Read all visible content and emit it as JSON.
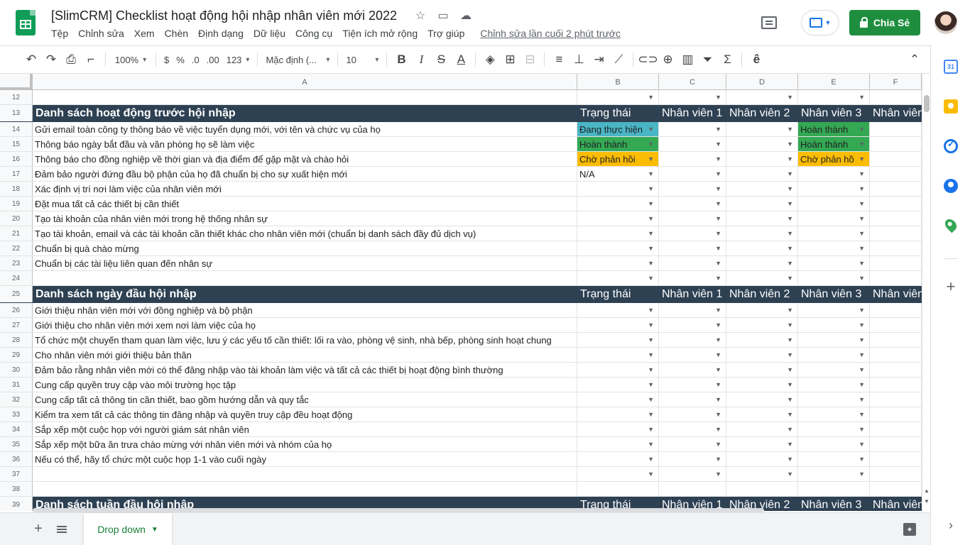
{
  "header": {
    "title": "[SlimCRM] Checklist hoạt động hội nhập nhân viên mới 2022",
    "menu": [
      "Tệp",
      "Chỉnh sửa",
      "Xem",
      "Chèn",
      "Định dạng",
      "Dữ liệu",
      "Công cụ",
      "Tiện ích mở rộng",
      "Trợ giúp"
    ],
    "last_edit": "Chỉnh sửa lần cuối 2 phút trước",
    "share_label": "Chia Sẻ"
  },
  "toolbar": {
    "zoom": "100%",
    "currency": "$",
    "percent": "%",
    "dec_decrease": ".0",
    "dec_increase": ".00",
    "format_more": "123",
    "font": "Mặc định (...",
    "font_size": "10"
  },
  "columns": [
    "A",
    "B",
    "C",
    "D",
    "E",
    "F"
  ],
  "rows": [
    {
      "n": "12",
      "type": "data",
      "a": "",
      "b": "",
      "c": "",
      "d": "",
      "e": ""
    },
    {
      "n": "13",
      "type": "header",
      "a": "Danh sách hoạt động trước hội nhập",
      "b": "Trạng thái",
      "c": "Nhân viên 1",
      "d": "Nhân viên 2",
      "e": "Nhân viên 3",
      "f": "Nhân viên"
    },
    {
      "n": "14",
      "type": "data",
      "a": "Gửi email toàn công ty thông báo về việc tuyển dụng mới, với tên và chức vụ của họ",
      "b": "Đang thực hiện",
      "c": "",
      "d": "",
      "e": "Hoàn thành"
    },
    {
      "n": "15",
      "type": "data",
      "a": "Thông báo ngày bắt đầu và văn phòng họ sẽ làm việc",
      "b": "Hoàn thành",
      "c": "",
      "d": "",
      "e": "Hoàn thành"
    },
    {
      "n": "16",
      "type": "data",
      "a": "Thông báo cho đồng nghiệp về thời gian và địa điểm để gặp mặt và chào hỏi",
      "b": "Chờ phản hồi",
      "c": "",
      "d": "",
      "e": "Chờ phản hồ"
    },
    {
      "n": "17",
      "type": "data",
      "a": " Đảm bảo người đứng đầu bộ phận của họ đã chuẩn bị cho sự xuất hiện mới",
      "b": "N/A",
      "c": "",
      "d": "",
      "e": ""
    },
    {
      "n": "18",
      "type": "data",
      "a": " Xác định vị trí nơi làm việc của nhân viên mới",
      "b": "",
      "c": "",
      "d": "",
      "e": ""
    },
    {
      "n": "19",
      "type": "data",
      "a": "Đặt mua tất cả các thiết bị cần thiết",
      "b": "",
      "c": "",
      "d": "",
      "e": ""
    },
    {
      "n": "20",
      "type": "data",
      "a": "Tạo tài khoản của nhân viên mới trong hệ thống nhân sự",
      "b": "",
      "c": "",
      "d": "",
      "e": ""
    },
    {
      "n": "21",
      "type": "data",
      "a": "Tạo tài khoản, email và các tài khoản cần thiết khác cho nhân viên mới (chuẩn bị danh sách đầy đủ dịch vụ)",
      "b": "",
      "c": "",
      "d": "",
      "e": ""
    },
    {
      "n": "22",
      "type": "data",
      "a": "Chuẩn bị quà chào mừng",
      "b": "",
      "c": "",
      "d": "",
      "e": ""
    },
    {
      "n": "23",
      "type": "data",
      "a": "Chuẩn bị các tài liệu liên quan đến nhân sự",
      "b": "",
      "c": "",
      "d": "",
      "e": ""
    },
    {
      "n": "24",
      "type": "data",
      "a": "",
      "b": "",
      "c": "",
      "d": "",
      "e": ""
    },
    {
      "n": "25",
      "type": "header",
      "a": "Danh sách ngày đầu hội nhập",
      "b": "Trạng thái",
      "c": "Nhân viên 1",
      "d": "Nhân viên 2",
      "e": "Nhân viên 3",
      "f": "Nhân viên"
    },
    {
      "n": "26",
      "type": "data",
      "a": "Giới thiệu nhân viên mới với đồng nghiệp và bộ phận",
      "b": "",
      "c": "",
      "d": "",
      "e": ""
    },
    {
      "n": "27",
      "type": "data",
      "a": "Giới thiệu cho nhân viên mới xem nơi làm việc của họ",
      "b": "",
      "c": "",
      "d": "",
      "e": ""
    },
    {
      "n": "28",
      "type": "data",
      "a": "Tổ chức một chuyến tham quan làm việc, lưu ý các yếu tố cần thiết: lối ra vào, phòng vệ sinh, nhà bếp, phòng sinh hoạt chung",
      "b": "",
      "c": "",
      "d": "",
      "e": ""
    },
    {
      "n": "29",
      "type": "data",
      "a": " Cho nhân viên mới giới thiệu bản thân",
      "b": "",
      "c": "",
      "d": "",
      "e": ""
    },
    {
      "n": "30",
      "type": "data",
      "a": "Đảm bảo rằng nhân viên mới có thể đăng nhập vào tài khoản làm việc và tất cả các thiết bị hoạt động bình thường",
      "b": "",
      "c": "",
      "d": "",
      "e": ""
    },
    {
      "n": "31",
      "type": "data",
      "a": "Cung cấp quyền truy cập vào môi trường học tập",
      "b": "",
      "c": "",
      "d": "",
      "e": ""
    },
    {
      "n": "32",
      "type": "data",
      "a": "Cung cấp tất cả thông tin cần thiết, bao gồm hướng dẫn và quy tắc",
      "b": "",
      "c": "",
      "d": "",
      "e": ""
    },
    {
      "n": "33",
      "type": "data",
      "a": "Kiểm tra xem tất cả các thông tin đăng nhập và quyền truy cập đều hoạt động",
      "b": "",
      "c": "",
      "d": "",
      "e": ""
    },
    {
      "n": "34",
      "type": "data",
      "a": "Sắp xếp một cuộc họp với người giám sát nhân viên",
      "b": "",
      "c": "",
      "d": "",
      "e": ""
    },
    {
      "n": "35",
      "type": "data",
      "a": "Sắp xếp một bữa ăn trưa chào mừng với nhân viên mới và nhóm của họ",
      "b": "",
      "c": "",
      "d": "",
      "e": ""
    },
    {
      "n": "36",
      "type": "data",
      "a": "Nếu có thể, hãy tổ chức một cuộc họp 1-1 vào cuối ngày",
      "b": "",
      "c": "",
      "d": "",
      "e": ""
    },
    {
      "n": "37",
      "type": "data",
      "a": "",
      "b": "",
      "c": "",
      "d": "",
      "e": ""
    },
    {
      "n": "38",
      "type": "blank",
      "a": ""
    },
    {
      "n": "39",
      "type": "header",
      "a": "Danh sách tuần đầu hội nhập",
      "b": "Trạng thái",
      "c": "Nhân viên 1",
      "d": "Nhân viên 2",
      "e": "Nhân viên 3",
      "f": "Nhân viên"
    }
  ],
  "status_colors": {
    "Đang thực hiện": "#4ab5c4",
    "Hoàn thành": "#34a853",
    "Chờ phản hồi": "#fbbc04",
    "Chờ phản hồ": "#fbbc04"
  },
  "header_row_color": "#2e4153",
  "sheet_tab": "Drop down",
  "side_panel": [
    "calendar-icon",
    "keep-icon",
    "tasks-icon",
    "contacts-icon",
    "maps-icon",
    "add-icon"
  ]
}
